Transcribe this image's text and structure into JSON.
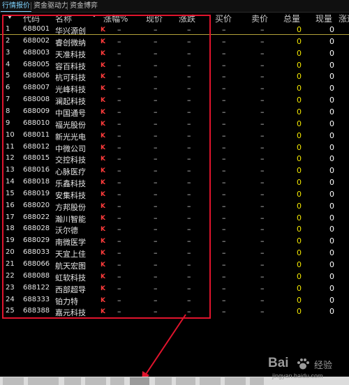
{
  "tabs": [
    {
      "label": "行情报价",
      "active": true
    },
    {
      "label": "资金驱动力",
      "active": false
    },
    {
      "label": "资金博弈",
      "active": false
    }
  ],
  "headers": {
    "code": "代码",
    "name": "名称",
    "marker": "•",
    "change_pct": "涨幅%",
    "price": "现价",
    "change": "涨跌",
    "bid": "买价",
    "ask": "卖价",
    "volume": "总量",
    "current_volume": "现量",
    "speed": "涨速"
  },
  "rows": [
    {
      "idx": "1",
      "code": "688001",
      "name": "华兴源创",
      "k": "K",
      "chg_pct": "–",
      "price": "–",
      "chg": "–",
      "bid": "–",
      "ask": "–",
      "vol": "0",
      "cur": "0"
    },
    {
      "idx": "2",
      "code": "688002",
      "name": "睿创微纳",
      "k": "K",
      "chg_pct": "–",
      "price": "–",
      "chg": "–",
      "bid": "–",
      "ask": "–",
      "vol": "0",
      "cur": "0"
    },
    {
      "idx": "3",
      "code": "688003",
      "name": "天准科技",
      "k": "K",
      "chg_pct": "–",
      "price": "–",
      "chg": "–",
      "bid": "–",
      "ask": "–",
      "vol": "0",
      "cur": "0"
    },
    {
      "idx": "4",
      "code": "688005",
      "name": "容百科技",
      "k": "K",
      "chg_pct": "–",
      "price": "–",
      "chg": "–",
      "bid": "–",
      "ask": "–",
      "vol": "0",
      "cur": "0"
    },
    {
      "idx": "5",
      "code": "688006",
      "name": "杭可科技",
      "k": "K",
      "chg_pct": "–",
      "price": "–",
      "chg": "–",
      "bid": "–",
      "ask": "–",
      "vol": "0",
      "cur": "0"
    },
    {
      "idx": "6",
      "code": "688007",
      "name": "光峰科技",
      "k": "K",
      "chg_pct": "–",
      "price": "–",
      "chg": "–",
      "bid": "–",
      "ask": "–",
      "vol": "0",
      "cur": "0"
    },
    {
      "idx": "7",
      "code": "688008",
      "name": "澜起科技",
      "k": "K",
      "chg_pct": "–",
      "price": "–",
      "chg": "–",
      "bid": "–",
      "ask": "–",
      "vol": "0",
      "cur": "0"
    },
    {
      "idx": "8",
      "code": "688009",
      "name": "中国通号",
      "k": "K",
      "chg_pct": "–",
      "price": "–",
      "chg": "–",
      "bid": "–",
      "ask": "–",
      "vol": "0",
      "cur": "0"
    },
    {
      "idx": "9",
      "code": "688010",
      "name": "福光股份",
      "k": "K",
      "chg_pct": "–",
      "price": "–",
      "chg": "–",
      "bid": "–",
      "ask": "–",
      "vol": "0",
      "cur": "0"
    },
    {
      "idx": "10",
      "code": "688011",
      "name": "新光光电",
      "k": "K",
      "chg_pct": "–",
      "price": "–",
      "chg": "–",
      "bid": "–",
      "ask": "–",
      "vol": "0",
      "cur": "0"
    },
    {
      "idx": "11",
      "code": "688012",
      "name": "中微公司",
      "k": "K",
      "chg_pct": "–",
      "price": "–",
      "chg": "–",
      "bid": "–",
      "ask": "–",
      "vol": "0",
      "cur": "0"
    },
    {
      "idx": "12",
      "code": "688015",
      "name": "交控科技",
      "k": "K",
      "chg_pct": "–",
      "price": "–",
      "chg": "–",
      "bid": "–",
      "ask": "–",
      "vol": "0",
      "cur": "0"
    },
    {
      "idx": "13",
      "code": "688016",
      "name": "心脉医疗",
      "k": "K",
      "chg_pct": "–",
      "price": "–",
      "chg": "–",
      "bid": "–",
      "ask": "–",
      "vol": "0",
      "cur": "0"
    },
    {
      "idx": "14",
      "code": "688018",
      "name": "乐鑫科技",
      "k": "K",
      "chg_pct": "–",
      "price": "–",
      "chg": "–",
      "bid": "–",
      "ask": "–",
      "vol": "0",
      "cur": "0"
    },
    {
      "idx": "15",
      "code": "688019",
      "name": "安集科技",
      "k": "K",
      "chg_pct": "–",
      "price": "–",
      "chg": "–",
      "bid": "–",
      "ask": "–",
      "vol": "0",
      "cur": "0"
    },
    {
      "idx": "16",
      "code": "688020",
      "name": "方邦股份",
      "k": "K",
      "chg_pct": "–",
      "price": "–",
      "chg": "–",
      "bid": "–",
      "ask": "–",
      "vol": "0",
      "cur": "0"
    },
    {
      "idx": "17",
      "code": "688022",
      "name": "瀚川智能",
      "k": "K",
      "chg_pct": "–",
      "price": "–",
      "chg": "–",
      "bid": "–",
      "ask": "–",
      "vol": "0",
      "cur": "0"
    },
    {
      "idx": "18",
      "code": "688028",
      "name": "沃尔德",
      "k": "K",
      "chg_pct": "–",
      "price": "–",
      "chg": "–",
      "bid": "–",
      "ask": "–",
      "vol": "0",
      "cur": "0"
    },
    {
      "idx": "19",
      "code": "688029",
      "name": "南微医学",
      "k": "K",
      "chg_pct": "–",
      "price": "–",
      "chg": "–",
      "bid": "–",
      "ask": "–",
      "vol": "0",
      "cur": "0"
    },
    {
      "idx": "20",
      "code": "688033",
      "name": "天宜上佳",
      "k": "K",
      "chg_pct": "–",
      "price": "–",
      "chg": "–",
      "bid": "–",
      "ask": "–",
      "vol": "0",
      "cur": "0"
    },
    {
      "idx": "21",
      "code": "688066",
      "name": "航天宏图",
      "k": "K",
      "chg_pct": "–",
      "price": "–",
      "chg": "–",
      "bid": "–",
      "ask": "–",
      "vol": "0",
      "cur": "0"
    },
    {
      "idx": "22",
      "code": "688088",
      "name": "虹软科技",
      "k": "K",
      "chg_pct": "–",
      "price": "–",
      "chg": "–",
      "bid": "–",
      "ask": "–",
      "vol": "0",
      "cur": "0"
    },
    {
      "idx": "23",
      "code": "688122",
      "name": "西部超导",
      "k": "K",
      "chg_pct": "–",
      "price": "–",
      "chg": "–",
      "bid": "–",
      "ask": "–",
      "vol": "0",
      "cur": "0"
    },
    {
      "idx": "24",
      "code": "688333",
      "name": "铂力特",
      "k": "K",
      "chg_pct": "–",
      "price": "–",
      "chg": "–",
      "bid": "–",
      "ask": "–",
      "vol": "0",
      "cur": "0"
    },
    {
      "idx": "25",
      "code": "688388",
      "name": "嘉元科技",
      "k": "K",
      "chg_pct": "–",
      "price": "–",
      "chg": "–",
      "bid": "–",
      "ask": "–",
      "vol": "0",
      "cur": "0"
    }
  ],
  "watermark": {
    "brand": "Bai",
    "brand_suffix": "经验",
    "url": "jingyan.baidu.com"
  },
  "colors": {
    "highlight_box": "#e0142d",
    "volume_text": "#f2e600",
    "k_marker": "#ff3b3b"
  }
}
